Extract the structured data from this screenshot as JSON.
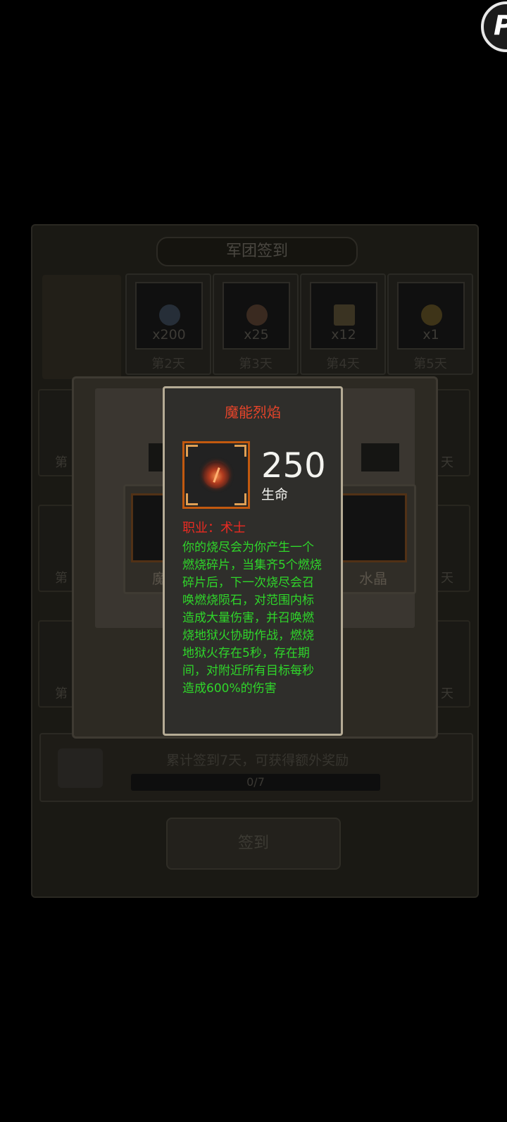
{
  "background": {
    "title": "军团签到",
    "days": [
      {
        "count": "x200",
        "label": "第2天"
      },
      {
        "count": "x25",
        "label": "第3天"
      },
      {
        "count": "x12",
        "label": "第4天"
      },
      {
        "count": "x1",
        "label": "第5天"
      }
    ],
    "side_labels": {
      "left_1": "第",
      "left_2": "第",
      "left_3": "第",
      "right_1": "天",
      "right_2": "天",
      "right_3": "天"
    },
    "progress_tip": "累计签到7天，可获得额外奖励",
    "progress_text": "0/7",
    "sign_button": "签到"
  },
  "reward_dialog": {
    "item_left_label": "魔能",
    "item_right_label": "水晶"
  },
  "tooltip": {
    "item_name": "魔能烈焰",
    "stat_value": "250",
    "stat_label": "生命",
    "class_line": "职业：术士",
    "description": "你的烧尽会为你产生一个燃烧碎片，当集齐5个燃烧碎片后，下一次烧尽会召唤燃烧陨石，对范围内标造成大量伤害，并召唤燃烧地狱火协助作战，燃烧地狱火存在5秒，存在期间，对附近所有目标每秒造成600%的伤害",
    "item_icon": "fire-orb-icon"
  },
  "floating_button": {
    "letter": "P"
  },
  "colors": {
    "item_name": "#e5442a",
    "class_text": "#ea2a22",
    "description": "#2fd62a",
    "frame": "#c2590f"
  }
}
